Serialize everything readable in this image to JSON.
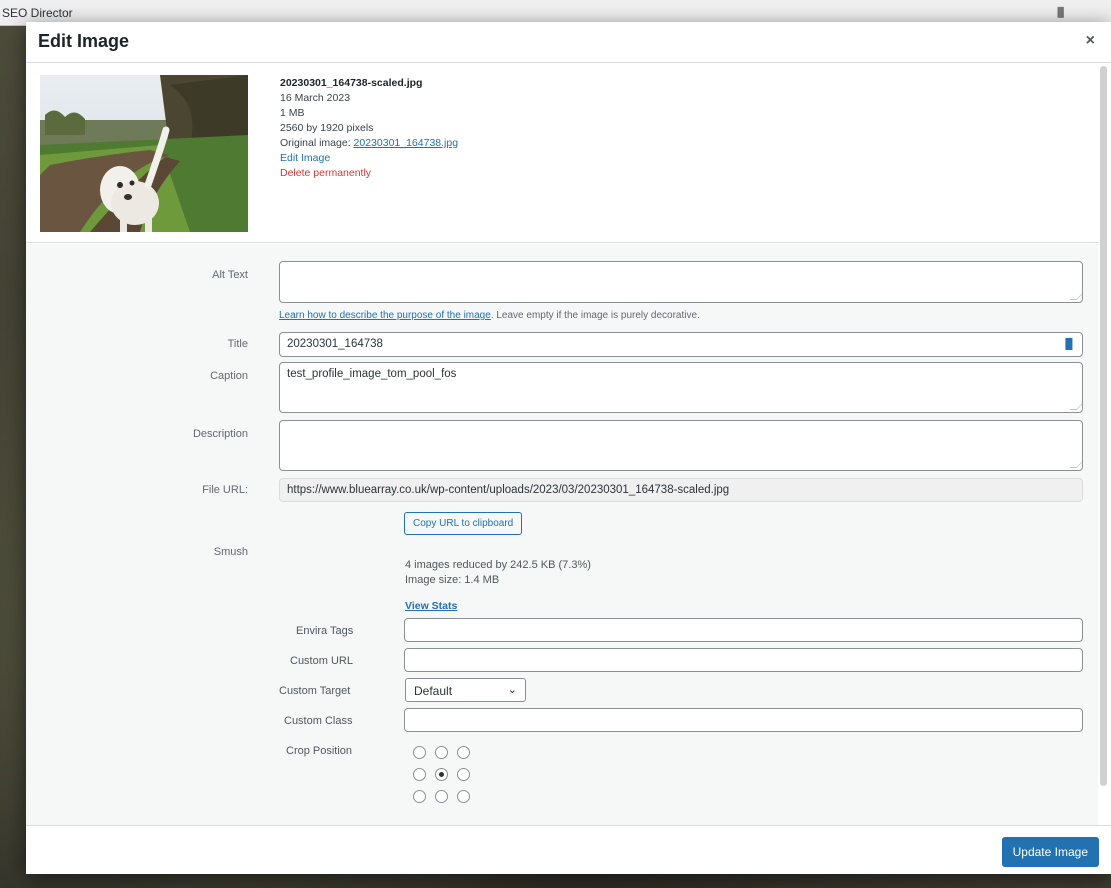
{
  "window": {
    "background_title": "SEO Director"
  },
  "modal": {
    "title": "Edit Image",
    "close_label": "×"
  },
  "file": {
    "name": "20230301_164738-scaled.jpg",
    "date": "16 March 2023",
    "size": "1 MB",
    "dimensions": "2560 by 1920 pixels",
    "original_label": "Original image: ",
    "original_link": "20230301_164738.jpg",
    "edit_link": "Edit Image",
    "delete_link": "Delete permanently"
  },
  "fields": {
    "alt_text": {
      "label": "Alt Text",
      "value": ""
    },
    "alt_help_link": "Learn how to describe the purpose of the image",
    "alt_help_text": ". Leave empty if the image is purely decorative.",
    "title": {
      "label": "Title",
      "value": "20230301_164738"
    },
    "caption": {
      "label": "Caption",
      "value": "test_profile_image_tom_pool_fos"
    },
    "description": {
      "label": "Description",
      "value": ""
    },
    "file_url": {
      "label": "File URL:",
      "value": "https://www.bluearray.co.uk/wp-content/uploads/2023/03/20230301_164738-scaled.jpg"
    },
    "copy_button": "Copy URL to clipboard"
  },
  "smush": {
    "label": "Smush",
    "line1": "4 images reduced by 242.5 KB (7.3%)",
    "line2": "Image size: 1.4 MB",
    "view_stats": "View Stats"
  },
  "envira": {
    "tags_label": "Envira Tags",
    "tags_value": "",
    "custom_url_label": "Custom URL",
    "custom_url_value": "",
    "custom_target_label": "Custom Target",
    "custom_target_value": "Default",
    "custom_class_label": "Custom Class",
    "custom_class_value": "",
    "crop_position_label": "Crop Position",
    "crop_selected": "center"
  },
  "footer": {
    "update_button": "Update Image"
  },
  "colors": {
    "primary": "#2271b1",
    "danger": "#d63638"
  }
}
